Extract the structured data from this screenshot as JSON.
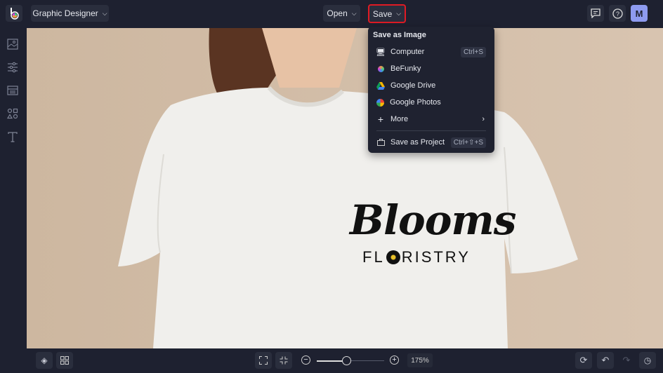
{
  "header": {
    "workspace_label": "Graphic Designer",
    "open_label": "Open",
    "save_label": "Save",
    "avatar_initial": "M"
  },
  "save_menu": {
    "heading": "Save as Image",
    "items": [
      {
        "label": "Computer",
        "shortcut": "Ctrl+S"
      },
      {
        "label": "BeFunky"
      },
      {
        "label": "Google Drive"
      },
      {
        "label": "Google Photos"
      },
      {
        "label": "More"
      },
      {
        "label": "Save as Project",
        "shortcut": "Ctrl+⇧+S"
      }
    ]
  },
  "canvas": {
    "logo_line1": "Blooms",
    "logo_line2_a": "FL",
    "logo_line2_b": "RISTRY"
  },
  "bottom": {
    "zoom_label": "175%",
    "zoom_value": 175
  },
  "colors": {
    "accent": "#e01b24",
    "bg": "#1e2130",
    "avatar": "#8e9bf0"
  }
}
